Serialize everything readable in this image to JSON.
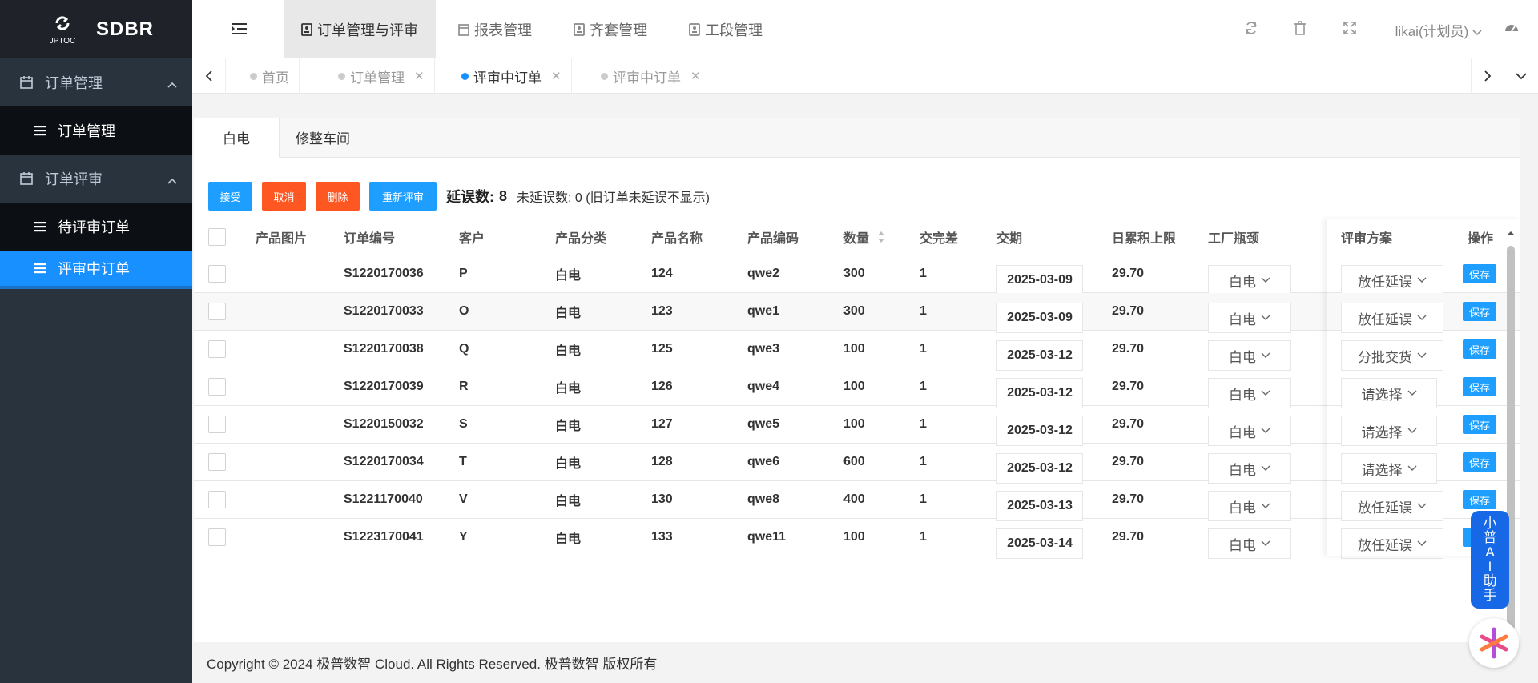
{
  "sidebar": {
    "logo_text": "JPTOC",
    "title": "SDBR",
    "groups": [
      {
        "label": "订单管理",
        "items": [
          {
            "label": "订单管理"
          }
        ]
      },
      {
        "label": "订单评审",
        "items": [
          {
            "label": "待评审订单"
          },
          {
            "label": "评审中订单"
          }
        ]
      }
    ]
  },
  "topnav": {
    "tabs": [
      {
        "label": "订单管理与评审",
        "active": true
      },
      {
        "label": "报表管理"
      },
      {
        "label": "齐套管理"
      },
      {
        "label": "工段管理"
      }
    ],
    "user": "likai(计划员)"
  },
  "tagsbar": {
    "tags": [
      {
        "label": "首页",
        "closable": false
      },
      {
        "label": "订单管理",
        "closable": true
      },
      {
        "label": "评审中订单",
        "closable": true,
        "active": true
      },
      {
        "label": "评审中订单",
        "closable": true
      }
    ]
  },
  "subtabs": [
    {
      "label": "白电"
    },
    {
      "label": "修整车间"
    }
  ],
  "toolbar": {
    "accept": "接受",
    "cancel": "取消",
    "delete": "删除",
    "rereview": "重新评审",
    "delay_label": "延误数:",
    "delay_count": "8",
    "not_delay": "未延误数:  0 (旧订单未延误不显示)"
  },
  "table": {
    "headers": {
      "img": "产品图片",
      "order": "订单编号",
      "customer": "客户",
      "category": "产品分类",
      "name": "产品名称",
      "code": "产品编码",
      "qty": "数量",
      "diff": "交完差",
      "date": "交期",
      "limit": "日累积上限",
      "factory": "工厂瓶颈",
      "plan": "评审方案",
      "op": "操作"
    },
    "rows": [
      {
        "order": "S1220170036",
        "customer": "P",
        "category": "白电",
        "name": "124",
        "code": "qwe2",
        "qty": "300",
        "diff": "1",
        "date": "2025-03-09",
        "limit": "29.70",
        "factory": "白电",
        "plan": "放任延误",
        "save": "保存"
      },
      {
        "order": "S1220170033",
        "customer": "O",
        "category": "白电",
        "name": "123",
        "code": "qwe1",
        "qty": "300",
        "diff": "1",
        "date": "2025-03-09",
        "limit": "29.70",
        "factory": "白电",
        "plan": "放任延误",
        "save": "保存"
      },
      {
        "order": "S1220170038",
        "customer": "Q",
        "category": "白电",
        "name": "125",
        "code": "qwe3",
        "qty": "100",
        "diff": "1",
        "date": "2025-03-12",
        "limit": "29.70",
        "factory": "白电",
        "plan": "分批交货",
        "save": "保存"
      },
      {
        "order": "S1220170039",
        "customer": "R",
        "category": "白电",
        "name": "126",
        "code": "qwe4",
        "qty": "100",
        "diff": "1",
        "date": "2025-03-12",
        "limit": "29.70",
        "factory": "白电",
        "plan": "请选择",
        "save": "保存"
      },
      {
        "order": "S1220150032",
        "customer": "S",
        "category": "白电",
        "name": "127",
        "code": "qwe5",
        "qty": "100",
        "diff": "1",
        "date": "2025-03-12",
        "limit": "29.70",
        "factory": "白电",
        "plan": "请选择",
        "save": "保存"
      },
      {
        "order": "S1220170034",
        "customer": "T",
        "category": "白电",
        "name": "128",
        "code": "qwe6",
        "qty": "600",
        "diff": "1",
        "date": "2025-03-12",
        "limit": "29.70",
        "factory": "白电",
        "plan": "请选择",
        "save": "保存"
      },
      {
        "order": "S1221170040",
        "customer": "V",
        "category": "白电",
        "name": "130",
        "code": "qwe8",
        "qty": "400",
        "diff": "1",
        "date": "2025-03-13",
        "limit": "29.70",
        "factory": "白电",
        "plan": "放任延误",
        "save": "保存"
      },
      {
        "order": "S1223170041",
        "customer": "Y",
        "category": "白电",
        "name": "133",
        "code": "qwe11",
        "qty": "100",
        "diff": "1",
        "date": "2025-03-14",
        "limit": "29.70",
        "factory": "白电",
        "plan": "放任延误",
        "save": ""
      }
    ]
  },
  "footer": "Copyright © 2024 极普数智 Cloud. All Rights Reserved. 极普数智 版权所有",
  "assistant": [
    "小",
    "普",
    "A",
    "I",
    "助",
    "手"
  ]
}
